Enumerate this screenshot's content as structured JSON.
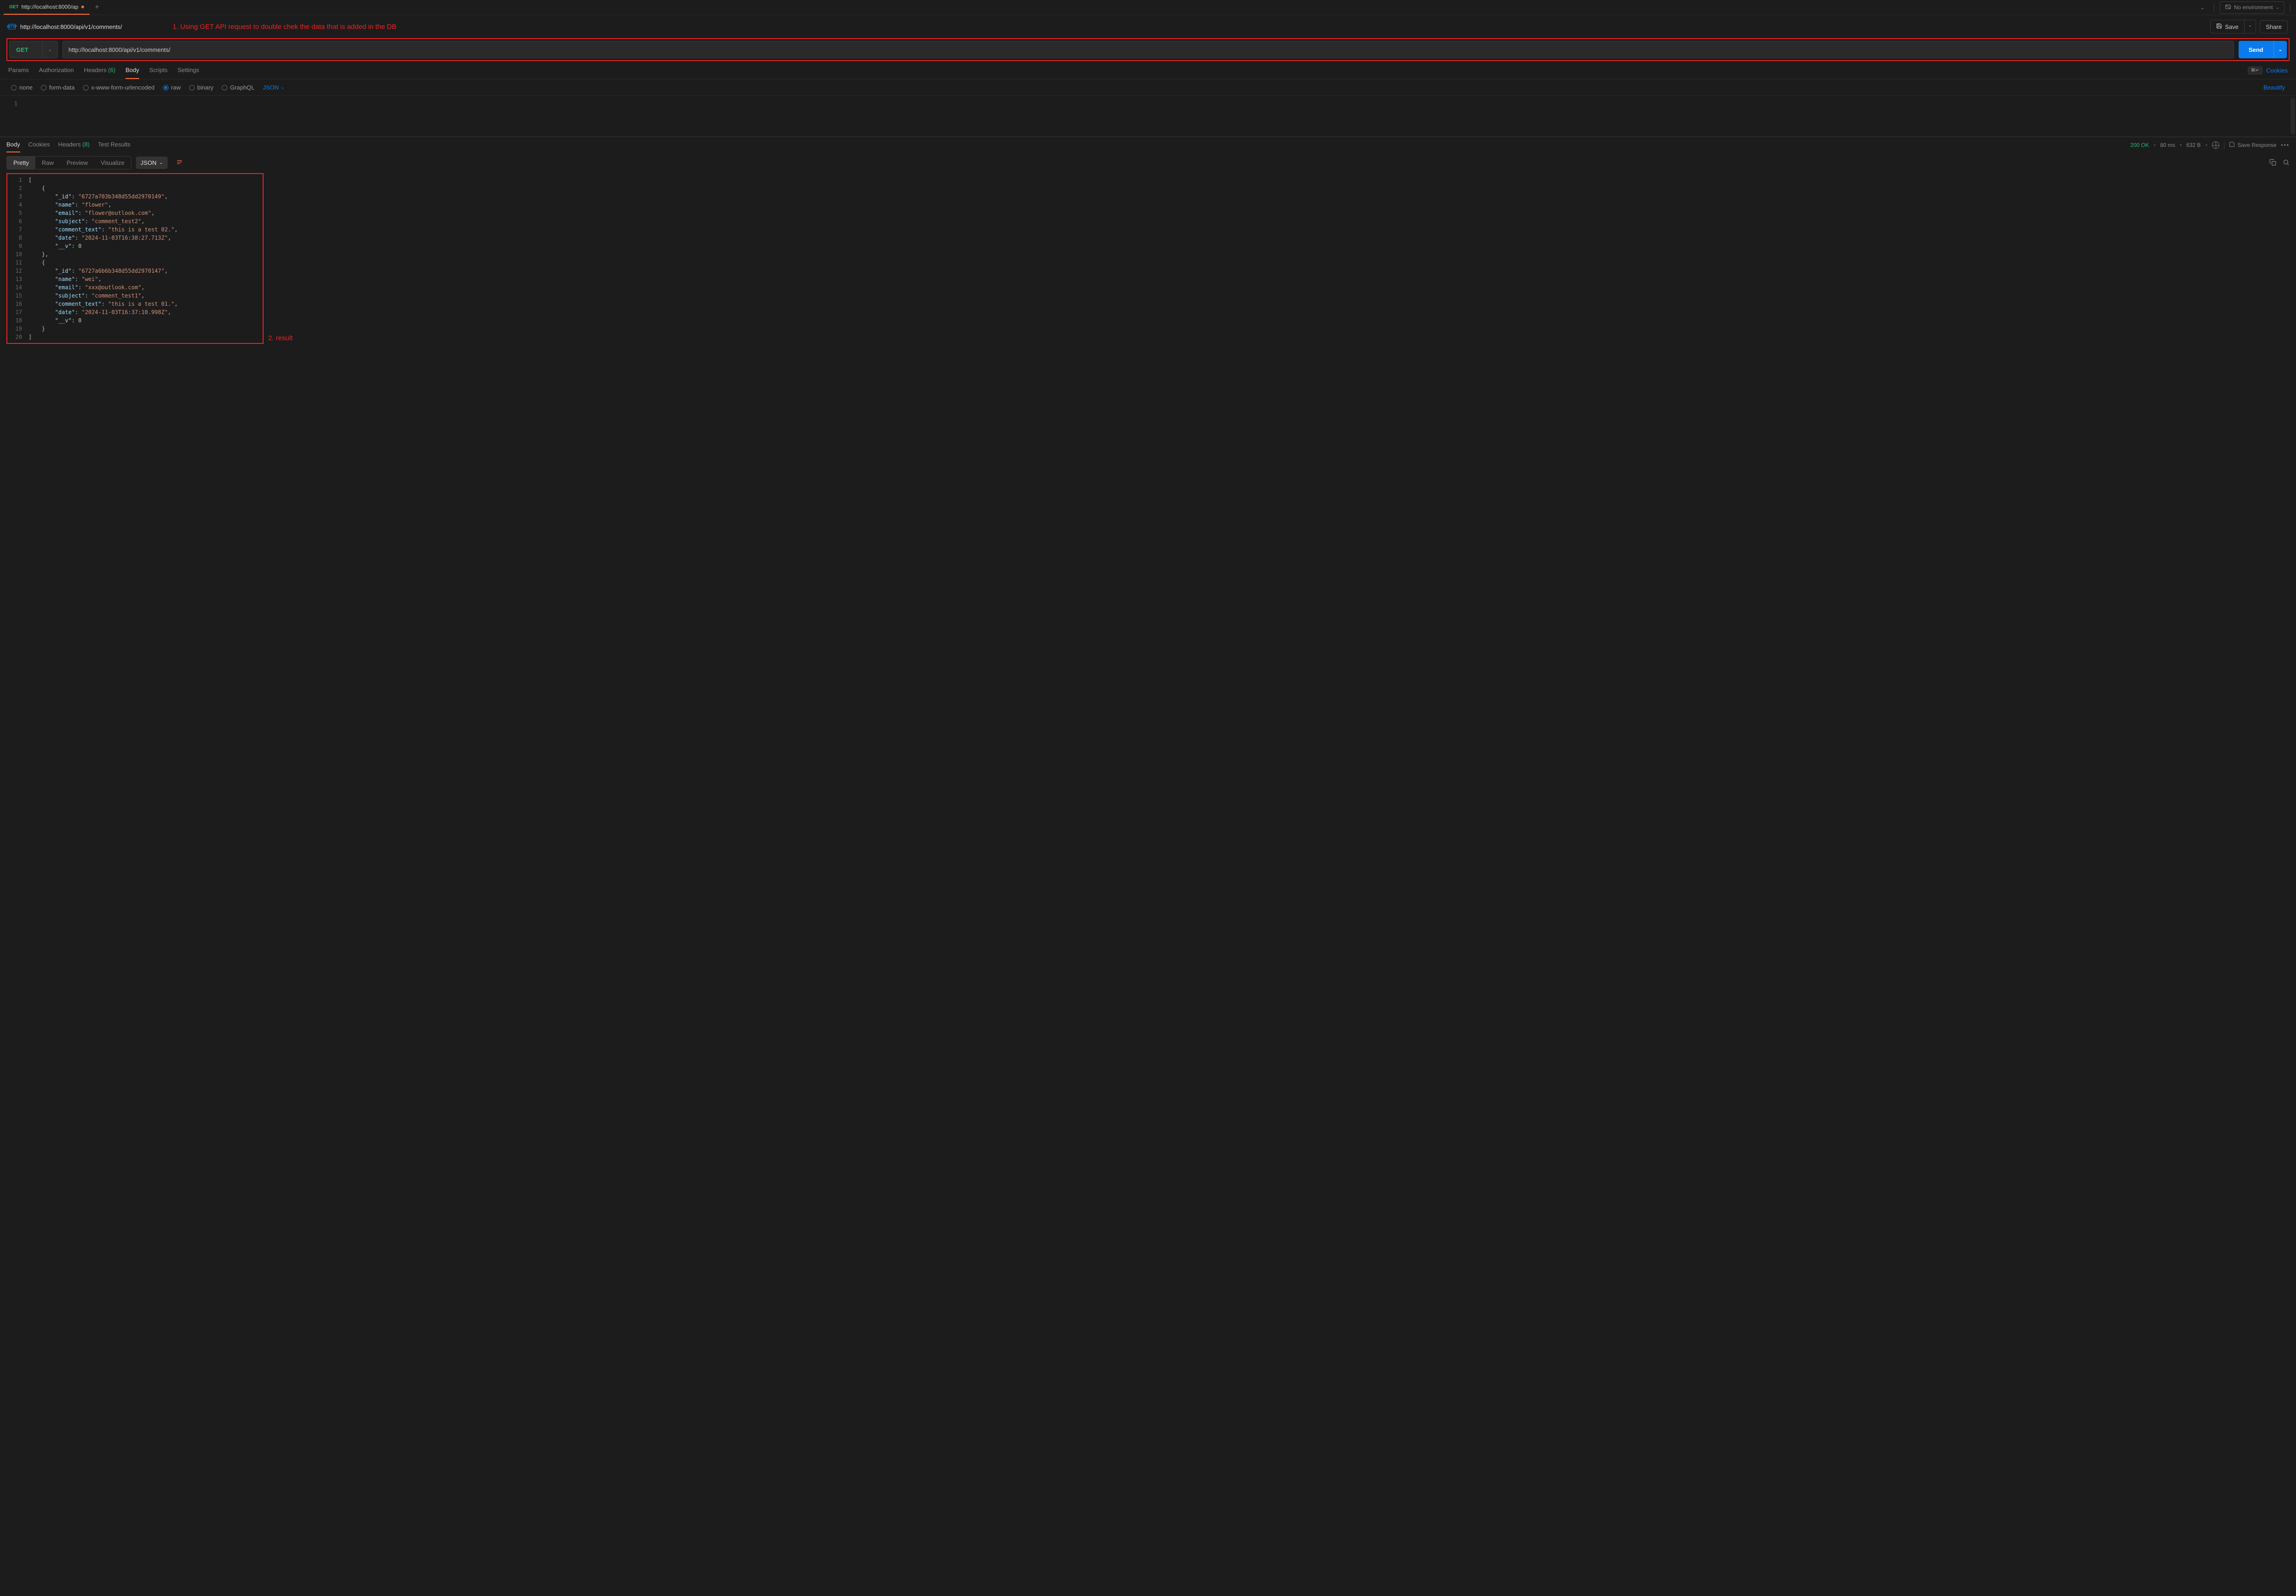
{
  "tab": {
    "method": "GET",
    "title": "http://localhost:8000/ap"
  },
  "env": {
    "label": "No environment"
  },
  "title": {
    "url": "http://localhost:8000/api/v1/comments/"
  },
  "annotations": {
    "one": "1. Using GET API request to double chek the data that is added in the DB",
    "two": "2. result"
  },
  "toolbar": {
    "save": "Save",
    "share": "Share"
  },
  "request": {
    "method": "GET",
    "url": "http://localhost:8000/api/v1/comments/",
    "send": "Send"
  },
  "reqTabs": {
    "params": "Params",
    "auth": "Authorization",
    "headers": "Headers",
    "headersCount": "(6)",
    "body": "Body",
    "scripts": "Scripts",
    "settings": "Settings",
    "shortcut": "⌘↵",
    "cookies": "Cookies"
  },
  "bodyTypes": {
    "none": "none",
    "formData": "form-data",
    "xwww": "x-www-form-urlencoded",
    "raw": "raw",
    "binary": "binary",
    "graphql": "GraphQL",
    "json": "JSON",
    "beautify": "Beautify"
  },
  "reqEditor": {
    "line1": "1"
  },
  "respTabs": {
    "body": "Body",
    "cookies": "Cookies",
    "headers": "Headers",
    "headersCount": "(8)",
    "testResults": "Test Results"
  },
  "respMeta": {
    "status": "200 OK",
    "time": "80 ms",
    "size": "632 B",
    "saveResponse": "Save Response"
  },
  "viewTabs": {
    "pretty": "Pretty",
    "raw": "Raw",
    "preview": "Preview",
    "visualize": "Visualize",
    "fmt": "JSON"
  },
  "responseBody": [
    {
      "n": 1,
      "tokens": [
        [
          "p",
          "["
        ]
      ]
    },
    {
      "n": 2,
      "tokens": [
        [
          "p",
          "    {"
        ]
      ]
    },
    {
      "n": 3,
      "tokens": [
        [
          "p",
          "        "
        ],
        [
          "k",
          "\"_id\""
        ],
        [
          "p",
          ": "
        ],
        [
          "s",
          "\"6727a703b348d55dd2970149\""
        ],
        [
          "p",
          ","
        ]
      ]
    },
    {
      "n": 4,
      "tokens": [
        [
          "p",
          "        "
        ],
        [
          "k",
          "\"name\""
        ],
        [
          "p",
          ": "
        ],
        [
          "s",
          "\"flower\""
        ],
        [
          "p",
          ","
        ]
      ]
    },
    {
      "n": 5,
      "tokens": [
        [
          "p",
          "        "
        ],
        [
          "k",
          "\"email\""
        ],
        [
          "p",
          ": "
        ],
        [
          "s",
          "\"flower@outlook.com\""
        ],
        [
          "p",
          ","
        ]
      ]
    },
    {
      "n": 6,
      "tokens": [
        [
          "p",
          "        "
        ],
        [
          "k",
          "\"subject\""
        ],
        [
          "p",
          ": "
        ],
        [
          "s",
          "\"comment_test2\""
        ],
        [
          "p",
          ","
        ]
      ]
    },
    {
      "n": 7,
      "tokens": [
        [
          "p",
          "        "
        ],
        [
          "k",
          "\"comment_text\""
        ],
        [
          "p",
          ": "
        ],
        [
          "s",
          "\"this is a test 02.\""
        ],
        [
          "p",
          ","
        ]
      ]
    },
    {
      "n": 8,
      "tokens": [
        [
          "p",
          "        "
        ],
        [
          "k",
          "\"date\""
        ],
        [
          "p",
          ": "
        ],
        [
          "s",
          "\"2024-11-03T16:38:27.713Z\""
        ],
        [
          "p",
          ","
        ]
      ]
    },
    {
      "n": 9,
      "tokens": [
        [
          "p",
          "        "
        ],
        [
          "k",
          "\"__v\""
        ],
        [
          "p",
          ": "
        ],
        [
          "n",
          "0"
        ]
      ]
    },
    {
      "n": 10,
      "tokens": [
        [
          "p",
          "    },"
        ]
      ]
    },
    {
      "n": 11,
      "tokens": [
        [
          "p",
          "    {"
        ]
      ]
    },
    {
      "n": 12,
      "tokens": [
        [
          "p",
          "        "
        ],
        [
          "k",
          "\"_id\""
        ],
        [
          "p",
          ": "
        ],
        [
          "s",
          "\"6727a6b6b348d55dd2970147\""
        ],
        [
          "p",
          ","
        ]
      ]
    },
    {
      "n": 13,
      "tokens": [
        [
          "p",
          "        "
        ],
        [
          "k",
          "\"name\""
        ],
        [
          "p",
          ": "
        ],
        [
          "s",
          "\"wei\""
        ],
        [
          "p",
          ","
        ]
      ]
    },
    {
      "n": 14,
      "tokens": [
        [
          "p",
          "        "
        ],
        [
          "k",
          "\"email\""
        ],
        [
          "p",
          ": "
        ],
        [
          "s",
          "\"xxx@outlook.com\""
        ],
        [
          "p",
          ","
        ]
      ]
    },
    {
      "n": 15,
      "tokens": [
        [
          "p",
          "        "
        ],
        [
          "k",
          "\"subject\""
        ],
        [
          "p",
          ": "
        ],
        [
          "s",
          "\"comment_test1\""
        ],
        [
          "p",
          ","
        ]
      ]
    },
    {
      "n": 16,
      "tokens": [
        [
          "p",
          "        "
        ],
        [
          "k",
          "\"comment_text\""
        ],
        [
          "p",
          ": "
        ],
        [
          "s",
          "\"this is a test 01.\""
        ],
        [
          "p",
          ","
        ]
      ]
    },
    {
      "n": 17,
      "tokens": [
        [
          "p",
          "        "
        ],
        [
          "k",
          "\"date\""
        ],
        [
          "p",
          ": "
        ],
        [
          "s",
          "\"2024-11-03T16:37:10.998Z\""
        ],
        [
          "p",
          ","
        ]
      ]
    },
    {
      "n": 18,
      "tokens": [
        [
          "p",
          "        "
        ],
        [
          "k",
          "\"__v\""
        ],
        [
          "p",
          ": "
        ],
        [
          "n",
          "0"
        ]
      ]
    },
    {
      "n": 19,
      "tokens": [
        [
          "p",
          "    }"
        ]
      ]
    },
    {
      "n": 20,
      "tokens": [
        [
          "p",
          "]"
        ]
      ]
    }
  ]
}
